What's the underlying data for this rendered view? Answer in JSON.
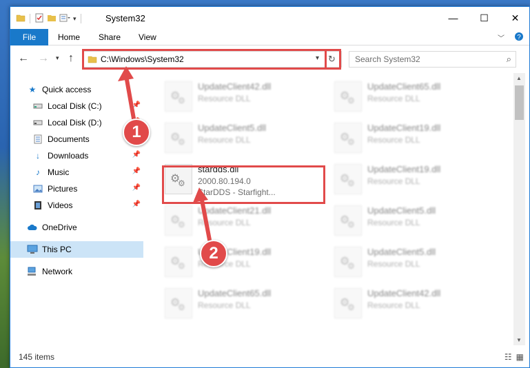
{
  "window": {
    "title": "System32",
    "minimize_label": "—",
    "maximize_label": "☐",
    "close_label": "✕"
  },
  "ribbon": {
    "file_tab": "File",
    "home_tab": "Home",
    "share_tab": "Share",
    "view_tab": "View"
  },
  "navbar": {
    "address_value": "C:\\Windows\\System32",
    "search_placeholder": "Search System32"
  },
  "sidebar": {
    "items": [
      {
        "label": "Quick access",
        "icon": "star-icon"
      },
      {
        "label": "Local Disk (C:)",
        "icon": "drive-icon"
      },
      {
        "label": "Local Disk (D:)",
        "icon": "drive-icon"
      },
      {
        "label": "Documents",
        "icon": "documents-icon"
      },
      {
        "label": "Downloads",
        "icon": "download-icon"
      },
      {
        "label": "Music",
        "icon": "music-icon"
      },
      {
        "label": "Pictures",
        "icon": "pictures-icon"
      },
      {
        "label": "Videos",
        "icon": "videos-icon"
      },
      {
        "label": "OneDrive",
        "icon": "cloud-icon"
      },
      {
        "label": "This PC",
        "icon": "computer-icon"
      },
      {
        "label": "Network",
        "icon": "network-icon"
      }
    ]
  },
  "files": {
    "left": [
      {
        "name": "UpdateClient42.dll",
        "desc": "Resource DLL"
      },
      {
        "name": "UpdateClient5.dll",
        "desc": "Resource DLL"
      },
      {
        "name": "stardds.dll",
        "desc": "2000.80.194.0",
        "sub": "StarDDS - Starfight..."
      },
      {
        "name": "UpdateClient21.dll",
        "desc": "Resource DLL"
      },
      {
        "name": "UpdateClient19.dll",
        "desc": "Resource DLL"
      },
      {
        "name": "UpdateClient65.dll",
        "desc": "Resource DLL"
      }
    ],
    "right": [
      {
        "name": "UpdateClient65.dll",
        "desc": "Resource DLL"
      },
      {
        "name": "UpdateClient19.dll",
        "desc": "Resource DLL"
      },
      {
        "name": "UpdateClient19.dll",
        "desc": "Resource DLL"
      },
      {
        "name": "UpdateClient5.dll",
        "desc": "Resource DLL"
      },
      {
        "name": "UpdateClient5.dll",
        "desc": "Resource DLL"
      },
      {
        "name": "UpdateClient42.dll",
        "desc": "Resource DLL"
      }
    ]
  },
  "status": {
    "item_count": "145 items"
  },
  "annotations": {
    "step1": "1",
    "step2": "2",
    "color": "#e14a4a"
  }
}
